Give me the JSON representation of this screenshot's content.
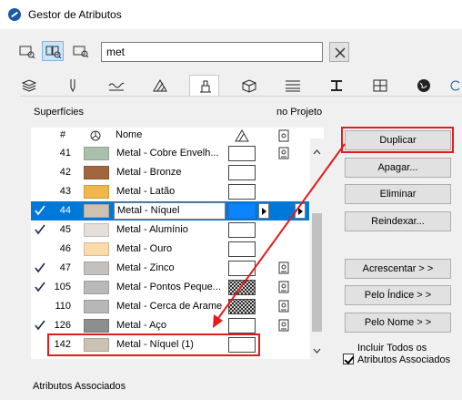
{
  "window": {
    "title": "Gestor de Atributos"
  },
  "toolbar": {
    "view_buttons": [
      "list-view-icon",
      "split-view-icon",
      "detail-view-icon"
    ],
    "search_value": "met"
  },
  "tabs": [
    "layers-icon",
    "pen-icon",
    "line-types-icon",
    "fills-icon",
    "surfaces-icon",
    "building-materials-icon",
    "composites-icon",
    "profiles-icon",
    "zones-icon",
    "globe-icon"
  ],
  "section": {
    "title": "Superfícies",
    "in_project": "no Projeto",
    "associated": "Atributos Associados"
  },
  "columns": {
    "num": "#",
    "name": "Nome"
  },
  "rows": [
    {
      "checked": false,
      "num": "41",
      "name": "Metal - Cobre Envelh...",
      "color": "#a9c1ac",
      "pattern": "none",
      "proj": true
    },
    {
      "checked": false,
      "num": "42",
      "name": "Metal - Bronze",
      "color": "#a0673c",
      "pattern": "none",
      "proj": false
    },
    {
      "checked": false,
      "num": "43",
      "name": "Metal - Latão",
      "color": "#f0b84a",
      "pattern": "none",
      "proj": false
    },
    {
      "checked": true,
      "num": "44",
      "name": "Metal - Níquel",
      "color": "#cbc2b2",
      "pattern": "none",
      "proj": false,
      "selected": true
    },
    {
      "checked": true,
      "num": "45",
      "name": "Metal - Alumínio",
      "color": "#e6dfd9",
      "pattern": "none",
      "proj": false
    },
    {
      "checked": false,
      "num": "46",
      "name": "Metal - Ouro",
      "color": "#fadcab",
      "pattern": "none",
      "proj": false
    },
    {
      "checked": true,
      "num": "47",
      "name": "Metal - Zinco",
      "color": "#c4c0bc",
      "pattern": "none",
      "proj": true
    },
    {
      "checked": true,
      "num": "105",
      "name": "Metal - Pontos Peque...",
      "color": "#b9b9b9",
      "pattern": "cross",
      "proj": true
    },
    {
      "checked": false,
      "num": "110",
      "name": "Metal - Cerca de Arame",
      "color": "#b7b7b7",
      "pattern": "cross",
      "proj": true
    },
    {
      "checked": true,
      "num": "126",
      "name": "Metal - Aço",
      "color": "#8e8e90",
      "pattern": "none",
      "proj": true
    },
    {
      "checked": false,
      "num": "142",
      "name": "Metal - Níquel (1)",
      "color": "#cbc2b2",
      "pattern": "none",
      "proj": false
    }
  ],
  "buttons": {
    "duplicate": "Duplicar",
    "delete": "Apagar...",
    "remove": "Eliminar",
    "reindex": "Reindexar...",
    "add": "Acrescentar > >",
    "by_index": "Pelo Índice > >",
    "by_name": "Pelo Nome > >"
  },
  "include_all": {
    "label": "Incluir Todos os Atributos Associados",
    "checked": true
  },
  "accent": {
    "selection": "#0078d7",
    "annotation": "#e21b1b"
  }
}
